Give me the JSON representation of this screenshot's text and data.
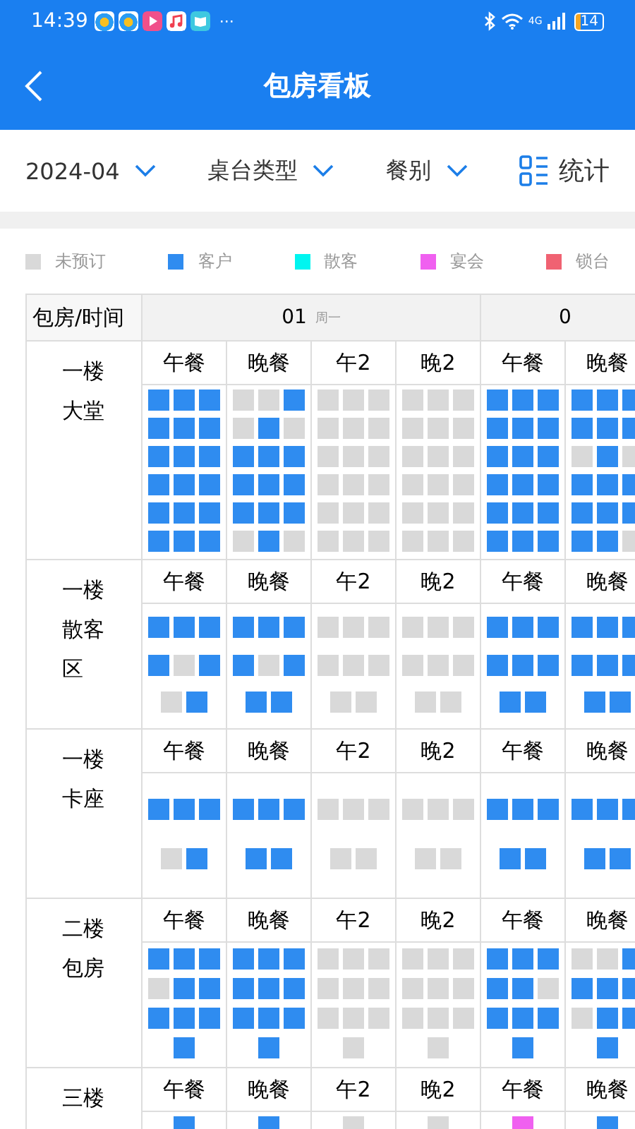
{
  "status_bar": {
    "time": "14:39",
    "more": "···",
    "network": "4G",
    "battery": "14"
  },
  "nav": {
    "title": "包房看板"
  },
  "filters": [
    {
      "label": "2024-04",
      "kind": "dropdown"
    },
    {
      "label": "桌台类型",
      "kind": "dropdown"
    },
    {
      "label": "餐别",
      "kind": "dropdown"
    },
    {
      "label": "统计",
      "kind": "stats"
    }
  ],
  "legend": [
    {
      "label": "未预订",
      "color": "#d9d9d9"
    },
    {
      "label": "客户",
      "color": "#2f8cf0"
    },
    {
      "label": "散客",
      "color": "#00f5f0"
    },
    {
      "label": "宴会",
      "color": "#f060f0"
    },
    {
      "label": "锁台",
      "color": "#f06272"
    }
  ],
  "table": {
    "corner": "包房/时间",
    "days": [
      {
        "day": "01",
        "weekday": "周一"
      },
      {
        "day": "0"
      }
    ],
    "sections": [
      {
        "room": "一楼大堂",
        "slots": [
          {
            "meal": "午餐",
            "rows": [
              [
                {
                  "color": "#2f8cf0"
                },
                {
                  "color": "#2f8cf0"
                },
                {
                  "color": "#2f8cf0"
                }
              ],
              [
                {
                  "color": "#2f8cf0"
                },
                {
                  "color": "#2f8cf0"
                },
                {
                  "color": "#2f8cf0"
                }
              ],
              [
                {
                  "color": "#2f8cf0"
                },
                {
                  "color": "#2f8cf0"
                },
                {
                  "color": "#2f8cf0"
                }
              ],
              [
                {
                  "color": "#2f8cf0"
                },
                {
                  "color": "#2f8cf0"
                },
                {
                  "color": "#2f8cf0"
                }
              ],
              [
                {
                  "color": "#2f8cf0"
                },
                {
                  "color": "#2f8cf0"
                },
                {
                  "color": "#2f8cf0"
                }
              ],
              [
                {
                  "color": "#2f8cf0"
                },
                {
                  "color": "#2f8cf0"
                },
                {
                  "color": "#2f8cf0"
                }
              ]
            ]
          },
          {
            "meal": "晚餐",
            "rows": [
              [
                {
                  "color": "#d9d9d9"
                },
                {
                  "color": "#d9d9d9"
                },
                {
                  "color": "#2f8cf0"
                }
              ],
              [
                {
                  "color": "#d9d9d9"
                },
                {
                  "color": "#2f8cf0"
                },
                {
                  "color": "#d9d9d9"
                }
              ],
              [
                {
                  "color": "#2f8cf0"
                },
                {
                  "color": "#2f8cf0"
                },
                {
                  "color": "#2f8cf0"
                }
              ],
              [
                {
                  "color": "#2f8cf0"
                },
                {
                  "color": "#2f8cf0"
                },
                {
                  "color": "#2f8cf0"
                }
              ],
              [
                {
                  "color": "#2f8cf0"
                },
                {
                  "color": "#2f8cf0"
                },
                {
                  "color": "#2f8cf0"
                }
              ],
              [
                {
                  "color": "#d9d9d9"
                },
                {
                  "color": "#2f8cf0"
                },
                {
                  "color": "#d9d9d9"
                }
              ]
            ]
          },
          {
            "meal": "午2",
            "rows": [
              [
                {
                  "color": "#d9d9d9"
                },
                {
                  "color": "#d9d9d9"
                },
                {
                  "color": "#d9d9d9"
                }
              ],
              [
                {
                  "color": "#d9d9d9"
                },
                {
                  "color": "#d9d9d9"
                },
                {
                  "color": "#d9d9d9"
                }
              ],
              [
                {
                  "color": "#d9d9d9"
                },
                {
                  "color": "#d9d9d9"
                },
                {
                  "color": "#d9d9d9"
                }
              ],
              [
                {
                  "color": "#d9d9d9"
                },
                {
                  "color": "#d9d9d9"
                },
                {
                  "color": "#d9d9d9"
                }
              ],
              [
                {
                  "color": "#d9d9d9"
                },
                {
                  "color": "#d9d9d9"
                },
                {
                  "color": "#d9d9d9"
                }
              ],
              [
                {
                  "color": "#d9d9d9"
                },
                {
                  "color": "#d9d9d9"
                },
                {
                  "color": "#d9d9d9"
                }
              ]
            ]
          },
          {
            "meal": "晚2",
            "rows": [
              [
                {
                  "color": "#d9d9d9"
                },
                {
                  "color": "#d9d9d9"
                },
                {
                  "color": "#d9d9d9"
                }
              ],
              [
                {
                  "color": "#d9d9d9"
                },
                {
                  "color": "#d9d9d9"
                },
                {
                  "color": "#d9d9d9"
                }
              ],
              [
                {
                  "color": "#d9d9d9"
                },
                {
                  "color": "#d9d9d9"
                },
                {
                  "color": "#d9d9d9"
                }
              ],
              [
                {
                  "color": "#d9d9d9"
                },
                {
                  "color": "#d9d9d9"
                },
                {
                  "color": "#d9d9d9"
                }
              ],
              [
                {
                  "color": "#d9d9d9"
                },
                {
                  "color": "#d9d9d9"
                },
                {
                  "color": "#d9d9d9"
                }
              ],
              [
                {
                  "color": "#d9d9d9"
                },
                {
                  "color": "#d9d9d9"
                },
                {
                  "color": "#d9d9d9"
                }
              ]
            ]
          },
          {
            "meal": "午餐",
            "rows": [
              [
                {
                  "color": "#2f8cf0"
                },
                {
                  "color": "#2f8cf0"
                },
                {
                  "color": "#2f8cf0"
                }
              ],
              [
                {
                  "color": "#2f8cf0"
                },
                {
                  "color": "#2f8cf0"
                },
                {
                  "color": "#2f8cf0"
                }
              ],
              [
                {
                  "color": "#2f8cf0"
                },
                {
                  "color": "#2f8cf0"
                },
                {
                  "color": "#2f8cf0"
                }
              ],
              [
                {
                  "color": "#2f8cf0"
                },
                {
                  "color": "#2f8cf0"
                },
                {
                  "color": "#2f8cf0"
                }
              ],
              [
                {
                  "color": "#2f8cf0"
                },
                {
                  "color": "#2f8cf0"
                },
                {
                  "color": "#2f8cf0"
                }
              ],
              [
                {
                  "color": "#2f8cf0"
                },
                {
                  "color": "#2f8cf0"
                },
                {
                  "color": "#2f8cf0"
                }
              ]
            ]
          },
          {
            "meal": "晚餐",
            "rows": [
              [
                {
                  "color": "#2f8cf0"
                },
                {
                  "color": "#2f8cf0"
                },
                {
                  "color": "#2f8cf0"
                }
              ],
              [
                {
                  "color": "#2f8cf0"
                },
                {
                  "color": "#2f8cf0"
                },
                {
                  "color": "#2f8cf0"
                }
              ],
              [
                {
                  "color": "#d9d9d9"
                },
                {
                  "color": "#2f8cf0"
                },
                {
                  "color": "#d9d9d9"
                }
              ],
              [
                {
                  "color": "#2f8cf0"
                },
                {
                  "color": "#2f8cf0"
                },
                {
                  "color": "#2f8cf0"
                }
              ],
              [
                {
                  "color": "#2f8cf0"
                },
                {
                  "color": "#2f8cf0"
                },
                {
                  "color": "#2f8cf0"
                }
              ],
              [
                {
                  "color": "#2f8cf0"
                },
                {
                  "color": "#2f8cf0"
                },
                {
                  "color": "#d9d9d9"
                }
              ]
            ]
          }
        ]
      },
      {
        "room": "一楼散客区",
        "slots": [
          {
            "meal": "午餐",
            "rows": [
              [
                {
                  "color": "#2f8cf0"
                },
                {
                  "color": "#2f8cf0"
                },
                {
                  "color": "#2f8cf0"
                }
              ],
              [
                {
                  "color": "#2f8cf0"
                },
                {
                  "color": "#d9d9d9"
                },
                {
                  "color": "#2f8cf0"
                }
              ],
              [
                {
                  "color": "#d9d9d9"
                },
                {
                  "color": "#2f8cf0"
                }
              ]
            ]
          },
          {
            "meal": "晚餐",
            "rows": [
              [
                {
                  "color": "#2f8cf0"
                },
                {
                  "color": "#2f8cf0"
                },
                {
                  "color": "#2f8cf0"
                }
              ],
              [
                {
                  "color": "#2f8cf0"
                },
                {
                  "color": "#d9d9d9"
                },
                {
                  "color": "#2f8cf0"
                }
              ],
              [
                {
                  "color": "#2f8cf0"
                },
                {
                  "color": "#2f8cf0"
                }
              ]
            ]
          },
          {
            "meal": "午2",
            "rows": [
              [
                {
                  "color": "#d9d9d9"
                },
                {
                  "color": "#d9d9d9"
                },
                {
                  "color": "#d9d9d9"
                }
              ],
              [
                {
                  "color": "#d9d9d9"
                },
                {
                  "color": "#d9d9d9"
                },
                {
                  "color": "#d9d9d9"
                }
              ],
              [
                {
                  "color": "#d9d9d9"
                },
                {
                  "color": "#d9d9d9"
                }
              ]
            ]
          },
          {
            "meal": "晚2",
            "rows": [
              [
                {
                  "color": "#d9d9d9"
                },
                {
                  "color": "#d9d9d9"
                },
                {
                  "color": "#d9d9d9"
                }
              ],
              [
                {
                  "color": "#d9d9d9"
                },
                {
                  "color": "#d9d9d9"
                },
                {
                  "color": "#d9d9d9"
                }
              ],
              [
                {
                  "color": "#d9d9d9"
                },
                {
                  "color": "#d9d9d9"
                }
              ]
            ]
          },
          {
            "meal": "午餐",
            "rows": [
              [
                {
                  "color": "#2f8cf0"
                },
                {
                  "color": "#2f8cf0"
                },
                {
                  "color": "#2f8cf0"
                }
              ],
              [
                {
                  "color": "#2f8cf0"
                },
                {
                  "color": "#2f8cf0"
                },
                {
                  "color": "#2f8cf0"
                }
              ],
              [
                {
                  "color": "#2f8cf0"
                },
                {
                  "color": "#2f8cf0"
                }
              ]
            ]
          },
          {
            "meal": "晚餐",
            "rows": [
              [
                {
                  "color": "#2f8cf0"
                },
                {
                  "color": "#2f8cf0"
                },
                {
                  "color": "#2f8cf0"
                }
              ],
              [
                {
                  "color": "#2f8cf0"
                },
                {
                  "color": "#2f8cf0"
                },
                {
                  "color": "#2f8cf0"
                }
              ],
              [
                {
                  "color": "#2f8cf0"
                },
                {
                  "color": "#2f8cf0"
                }
              ]
            ]
          }
        ]
      },
      {
        "room": "一楼卡座",
        "slots": [
          {
            "meal": "午餐",
            "rows": [
              [
                {
                  "color": "#2f8cf0"
                },
                {
                  "color": "#2f8cf0"
                },
                {
                  "color": "#2f8cf0"
                }
              ],
              [
                {
                  "color": "#d9d9d9"
                },
                {
                  "color": "#2f8cf0"
                }
              ]
            ]
          },
          {
            "meal": "晚餐",
            "rows": [
              [
                {
                  "color": "#2f8cf0"
                },
                {
                  "color": "#2f8cf0"
                },
                {
                  "color": "#2f8cf0"
                }
              ],
              [
                {
                  "color": "#2f8cf0"
                },
                {
                  "color": "#2f8cf0"
                }
              ]
            ]
          },
          {
            "meal": "午2",
            "rows": [
              [
                {
                  "color": "#d9d9d9"
                },
                {
                  "color": "#d9d9d9"
                },
                {
                  "color": "#d9d9d9"
                }
              ],
              [
                {
                  "color": "#d9d9d9"
                },
                {
                  "color": "#d9d9d9"
                }
              ]
            ]
          },
          {
            "meal": "晚2",
            "rows": [
              [
                {
                  "color": "#d9d9d9"
                },
                {
                  "color": "#d9d9d9"
                },
                {
                  "color": "#d9d9d9"
                }
              ],
              [
                {
                  "color": "#d9d9d9"
                },
                {
                  "color": "#d9d9d9"
                }
              ]
            ]
          },
          {
            "meal": "午餐",
            "rows": [
              [
                {
                  "color": "#2f8cf0"
                },
                {
                  "color": "#2f8cf0"
                },
                {
                  "color": "#2f8cf0"
                }
              ],
              [
                {
                  "color": "#2f8cf0"
                },
                {
                  "color": "#2f8cf0"
                }
              ]
            ]
          },
          {
            "meal": "晚餐",
            "rows": [
              [
                {
                  "color": "#2f8cf0"
                },
                {
                  "color": "#2f8cf0"
                },
                {
                  "color": "#2f8cf0"
                }
              ],
              [
                {
                  "color": "#2f8cf0"
                },
                {
                  "color": "#2f8cf0"
                }
              ]
            ]
          }
        ]
      },
      {
        "room": "二楼包房",
        "slots": [
          {
            "meal": "午餐",
            "rows": [
              [
                {
                  "color": "#2f8cf0"
                },
                {
                  "color": "#2f8cf0"
                },
                {
                  "color": "#2f8cf0"
                }
              ],
              [
                {
                  "color": "#d9d9d9"
                },
                {
                  "color": "#2f8cf0"
                },
                {
                  "color": "#2f8cf0"
                }
              ],
              [
                {
                  "color": "#2f8cf0"
                },
                {
                  "color": "#2f8cf0"
                },
                {
                  "color": "#2f8cf0"
                }
              ],
              [
                {
                  "color": "#2f8cf0"
                }
              ]
            ]
          },
          {
            "meal": "晚餐",
            "rows": [
              [
                {
                  "color": "#2f8cf0"
                },
                {
                  "color": "#2f8cf0"
                },
                {
                  "color": "#2f8cf0"
                }
              ],
              [
                {
                  "color": "#2f8cf0"
                },
                {
                  "color": "#2f8cf0"
                },
                {
                  "color": "#2f8cf0"
                }
              ],
              [
                {
                  "color": "#2f8cf0"
                },
                {
                  "color": "#2f8cf0"
                },
                {
                  "color": "#2f8cf0"
                }
              ],
              [
                {
                  "color": "#2f8cf0"
                }
              ]
            ]
          },
          {
            "meal": "午2",
            "rows": [
              [
                {
                  "color": "#d9d9d9"
                },
                {
                  "color": "#d9d9d9"
                },
                {
                  "color": "#d9d9d9"
                }
              ],
              [
                {
                  "color": "#d9d9d9"
                },
                {
                  "color": "#d9d9d9"
                },
                {
                  "color": "#d9d9d9"
                }
              ],
              [
                {
                  "color": "#d9d9d9"
                },
                {
                  "color": "#d9d9d9"
                },
                {
                  "color": "#d9d9d9"
                }
              ],
              [
                {
                  "color": "#d9d9d9"
                }
              ]
            ]
          },
          {
            "meal": "晚2",
            "rows": [
              [
                {
                  "color": "#d9d9d9"
                },
                {
                  "color": "#d9d9d9"
                },
                {
                  "color": "#d9d9d9"
                }
              ],
              [
                {
                  "color": "#d9d9d9"
                },
                {
                  "color": "#d9d9d9"
                },
                {
                  "color": "#d9d9d9"
                }
              ],
              [
                {
                  "color": "#d9d9d9"
                },
                {
                  "color": "#d9d9d9"
                },
                {
                  "color": "#d9d9d9"
                }
              ],
              [
                {
                  "color": "#d9d9d9"
                }
              ]
            ]
          },
          {
            "meal": "午餐",
            "rows": [
              [
                {
                  "color": "#2f8cf0"
                },
                {
                  "color": "#2f8cf0"
                },
                {
                  "color": "#2f8cf0"
                }
              ],
              [
                {
                  "color": "#2f8cf0"
                },
                {
                  "color": "#2f8cf0"
                },
                {
                  "color": "#d9d9d9"
                }
              ],
              [
                {
                  "color": "#2f8cf0"
                },
                {
                  "color": "#2f8cf0"
                },
                {
                  "color": "#2f8cf0"
                }
              ],
              [
                {
                  "color": "#2f8cf0"
                }
              ]
            ]
          },
          {
            "meal": "晚餐",
            "rows": [
              [
                {
                  "color": "#d9d9d9"
                },
                {
                  "color": "#d9d9d9"
                },
                {
                  "color": "#2f8cf0"
                }
              ],
              [
                {
                  "color": "#2f8cf0"
                },
                {
                  "color": "#2f8cf0"
                },
                {
                  "color": "#2f8cf0"
                }
              ],
              [
                {
                  "color": "#d9d9d9"
                },
                {
                  "color": "#2f8cf0"
                },
                {
                  "color": "#2f8cf0"
                }
              ],
              [
                {
                  "color": "#2f8cf0"
                }
              ]
            ]
          }
        ]
      },
      {
        "room": "三楼",
        "slots": [
          {
            "meal": "午餐",
            "rows": [
              [
                {
                  "color": "#2f8cf0"
                }
              ]
            ]
          },
          {
            "meal": "晚餐",
            "rows": [
              [
                {
                  "color": "#2f8cf0"
                }
              ]
            ]
          },
          {
            "meal": "午2",
            "rows": [
              [
                {
                  "color": "#d9d9d9"
                }
              ]
            ]
          },
          {
            "meal": "晚2",
            "rows": [
              [
                {
                  "color": "#d9d9d9"
                }
              ]
            ]
          },
          {
            "meal": "午餐",
            "rows": [
              [
                {
                  "color": "#f060f0"
                }
              ]
            ]
          },
          {
            "meal": "晚餐",
            "rows": [
              [
                {
                  "color": "#2f8cf0"
                }
              ]
            ]
          }
        ]
      }
    ]
  }
}
